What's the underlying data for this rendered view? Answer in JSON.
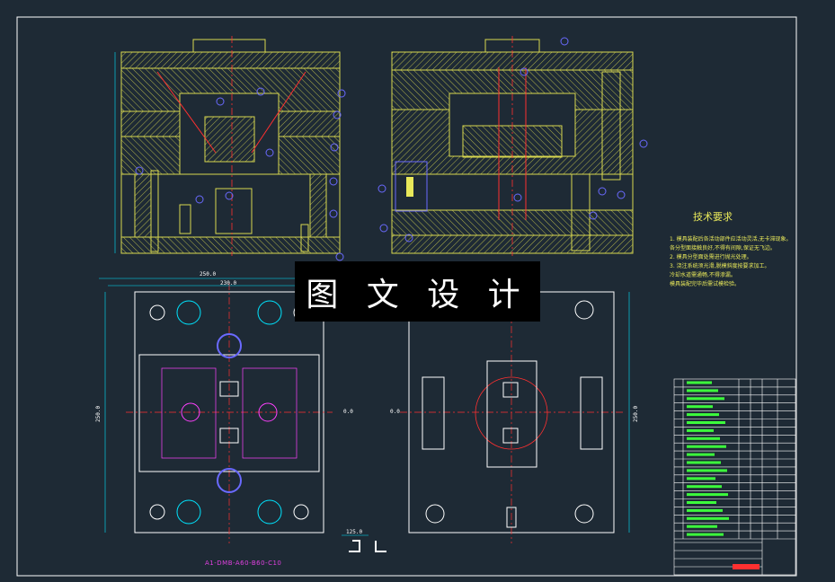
{
  "overlay": {
    "title": "图 文 设 计"
  },
  "tech": {
    "title": "技术要求",
    "notes": [
      "1. 模具装配后各活动部件应活动灵活,无卡滞现象。",
      "各分型面接触良好,不得有间隙,保证无飞边。",
      "2. 模具分型面处需进行抛光处理。",
      "3. 浇注系统须光滑,脱模斜度按要求加工。",
      "冷却水道需通畅,不得渗漏。",
      "模具装配完毕后需试模检验。"
    ]
  },
  "drawing_no": "A1-DMB-A60-B60-C10",
  "dims": {
    "top_width_outer": "250.0",
    "top_width_inner": "230.0",
    "left_height": "250.0",
    "right_height": "250.0",
    "bottom_a": "125.0",
    "center_mark": "0.0"
  },
  "balloons_count": 22,
  "colors": {
    "background": "#1e2a35",
    "frame": "#ffffff",
    "hatch": "#e8e85a",
    "centerline": "#ff3030",
    "dimension": "#00e5ff",
    "balloon": "#6a6aff",
    "green": "#3cff3c",
    "magenta": "#ff40ff"
  },
  "title_block": {
    "rows": 20
  }
}
